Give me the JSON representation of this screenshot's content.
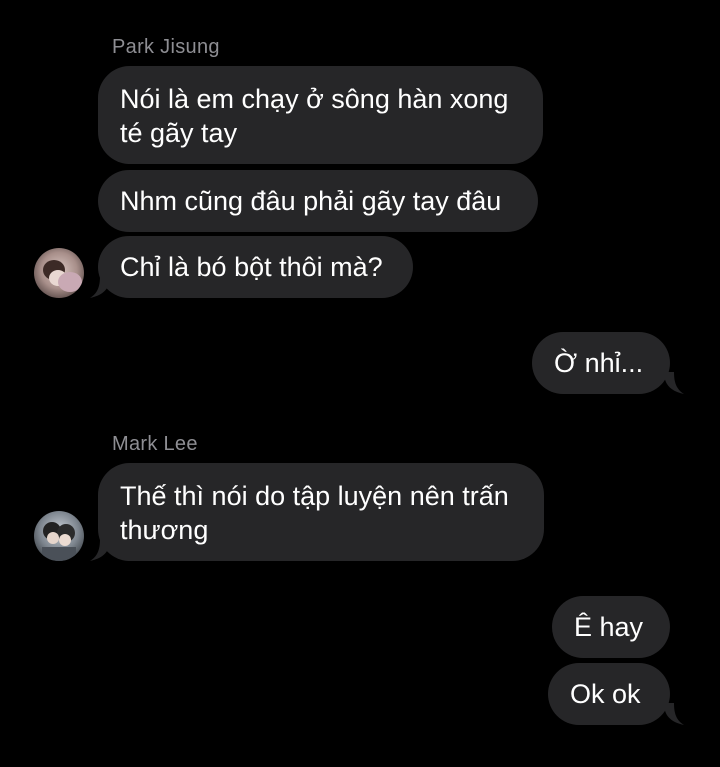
{
  "conversation": {
    "groups": [
      {
        "sender": "Park Jisung",
        "messages": [
          "Nói là em chạy ở sông hàn xong té gãy tay",
          "Nhm cũng đâu phải gãy tay đâu",
          "Chỉ là bó bột thôi mà?"
        ]
      },
      {
        "sender": "me",
        "messages": [
          "Ờ nhỉ..."
        ]
      },
      {
        "sender": "Mark Lee",
        "messages": [
          "Thế thì nói do tập luyện nên trấn thương"
        ]
      },
      {
        "sender": "me",
        "messages": [
          "Ê hay",
          "Ok ok"
        ]
      }
    ]
  },
  "labels": {
    "park_jisung": "Park Jisung",
    "mark_lee": "Mark Lee"
  },
  "messages": {
    "m1": "Nói là em chạy ở sông hàn xong té gãy tay",
    "m2": "Nhm cũng đâu phải gãy tay đâu",
    "m3": "Chỉ là bó bột thôi mà?",
    "m4": "Ờ nhỉ...",
    "m5": "Thế thì nói do tập luyện nên trấn thương",
    "m6": "Ê hay",
    "m7": "Ok ok"
  },
  "icons": {
    "avatar_park": "avatar-park-jisung",
    "avatar_mark": "avatar-mark-lee"
  },
  "colors": {
    "background": "#000000",
    "bubble": "#262628",
    "sender_name": "#8e8e93",
    "text": "#ffffff"
  }
}
